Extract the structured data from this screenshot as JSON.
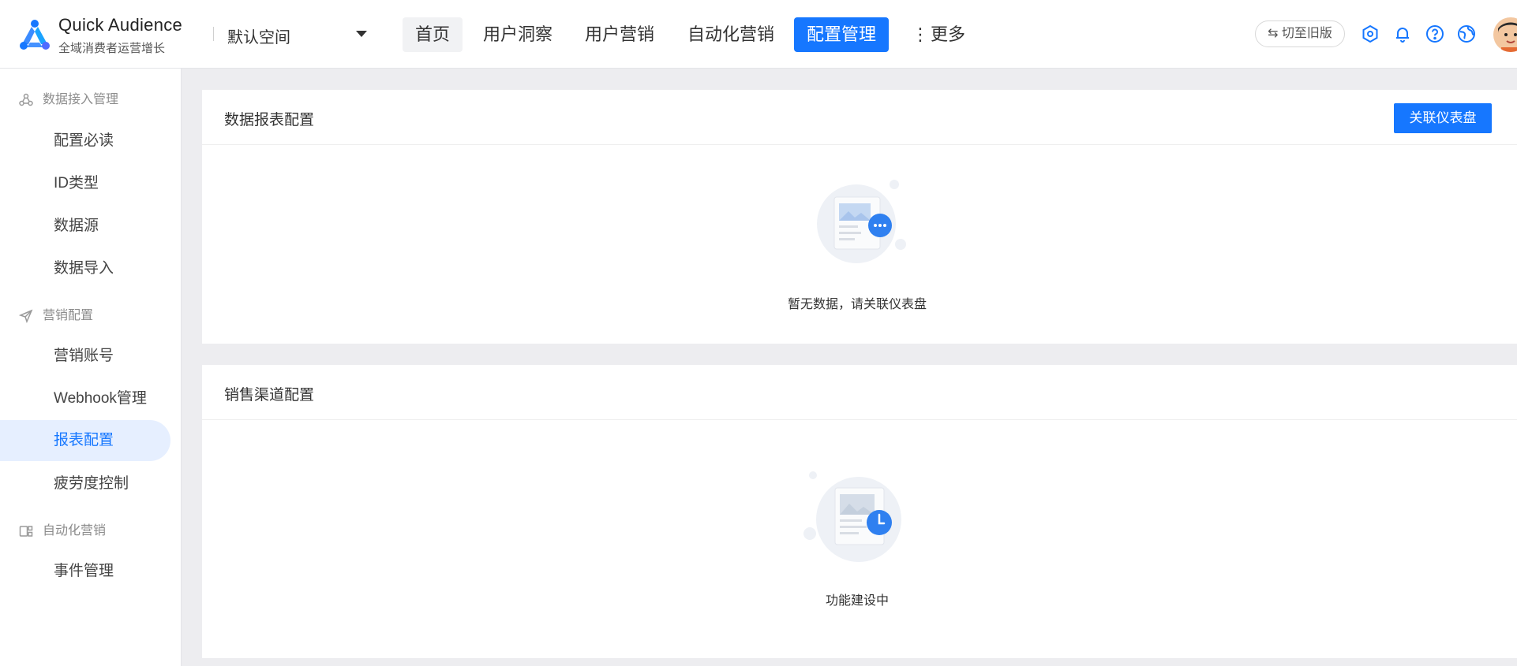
{
  "brand": {
    "name": "Quick Audience",
    "tagline": "全域消费者运营增长"
  },
  "workspace": {
    "selected": "默认空间"
  },
  "nav": {
    "items": [
      {
        "label": "首页"
      },
      {
        "label": "用户洞察"
      },
      {
        "label": "用户营销"
      },
      {
        "label": "自动化营销"
      },
      {
        "label": "配置管理"
      },
      {
        "label": "更多"
      }
    ],
    "active": "配置管理"
  },
  "header": {
    "switch_label": "⇆ 切至旧版"
  },
  "sidebar": {
    "groups": [
      {
        "label": "数据接入管理",
        "items": [
          {
            "label": "配置必读"
          },
          {
            "label": "ID类型"
          },
          {
            "label": "数据源"
          },
          {
            "label": "数据导入"
          }
        ]
      },
      {
        "label": "营销配置",
        "items": [
          {
            "label": "营销账号"
          },
          {
            "label": "Webhook管理"
          },
          {
            "label": "报表配置"
          },
          {
            "label": "疲劳度控制"
          }
        ]
      },
      {
        "label": "自动化营销",
        "items": [
          {
            "label": "事件管理"
          }
        ]
      }
    ],
    "active_item": "报表配置"
  },
  "cards": {
    "report": {
      "title": "数据报表配置",
      "button_label": "关联仪表盘",
      "empty_text": "暂无数据，请关联仪表盘"
    },
    "channel": {
      "title": "销售渠道配置",
      "empty_text": "功能建设中"
    }
  },
  "colors": {
    "accent": "#1677ff",
    "active_bg": "#e6efff",
    "page_bg": "#ededf0"
  }
}
